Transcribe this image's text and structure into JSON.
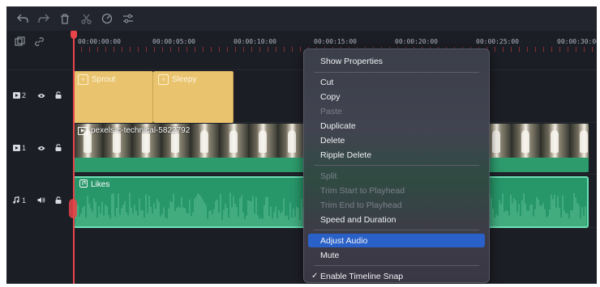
{
  "toolbar": {
    "icons": [
      "undo-icon",
      "redo-icon",
      "delete-icon",
      "cut-icon",
      "speed-icon",
      "adjust-icon"
    ]
  },
  "ruler": {
    "timecodes": [
      "00:00:00:00",
      "00:00:05:00",
      "00:00:10:00",
      "00:00:15:00",
      "00:00:20:00",
      "00:00:25:00",
      "00:00:30:00"
    ]
  },
  "tracks": {
    "title_track": {
      "number": "2",
      "clips": [
        "Sprout",
        "Sleepy"
      ]
    },
    "video_track": {
      "number": "1",
      "clip_name": "pexels-c-technical-5822792"
    },
    "audio_track": {
      "number": "1",
      "clip_name": "Likes"
    }
  },
  "context_menu": {
    "show_properties": "Show Properties",
    "cut": "Cut",
    "copy": "Copy",
    "paste": "Paste",
    "duplicate": "Duplicate",
    "delete": "Delete",
    "ripple_delete": "Ripple Delete",
    "split": "Split",
    "trim_start": "Trim Start to Playhead",
    "trim_end": "Trim End to Playhead",
    "speed_duration": "Speed and Duration",
    "adjust_audio": "Adjust Audio",
    "mute": "Mute",
    "enable_snap": "Enable Timeline Snap",
    "check_mark": "✓"
  },
  "colors": {
    "title_clip": "#e9c36e",
    "video_clip": "#2d9b6c",
    "audio_clip": "#279669",
    "playhead": "#e8444a",
    "menu_highlight": "#2a61c9"
  }
}
